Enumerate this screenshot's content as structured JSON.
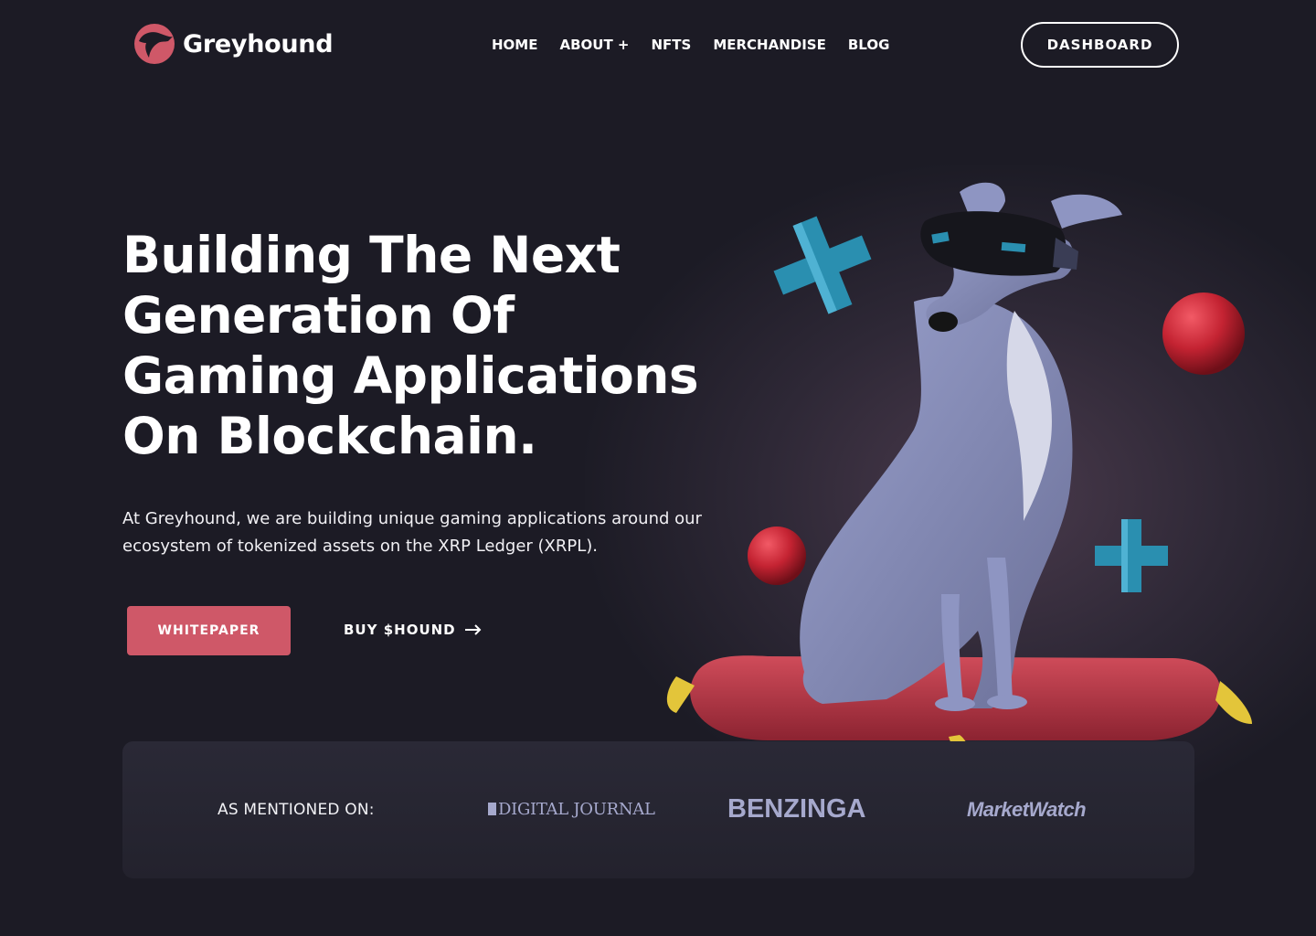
{
  "header": {
    "brand": "Greyhound",
    "nav": [
      "HOME",
      "ABOUT +",
      "NFTS",
      "MERCHANDISE",
      "BLOG"
    ],
    "dashboard_label": "DASHBOARD"
  },
  "hero": {
    "headline": "Building The Next Generation Of Gaming Applications On Blockchain.",
    "subtext": "At Greyhound, we are building unique gaming applications around our ecosystem of tokenized assets on the XRP Ledger (XRPL).",
    "primary_cta": "WHITEPAPER",
    "secondary_cta": "BUY $HOUND",
    "secondary_icon": "arrow-right-icon"
  },
  "press": {
    "label": "AS MENTIONED ON:",
    "logos": [
      "DIGITAL JOURNAL",
      "BENZINGA",
      "MarketWatch"
    ]
  },
  "colors": {
    "background": "#1c1b25",
    "accent": "#cf5868",
    "press_logo": "#a6a9cd",
    "cross": "#2a8fb0",
    "ball": "#c42332"
  }
}
